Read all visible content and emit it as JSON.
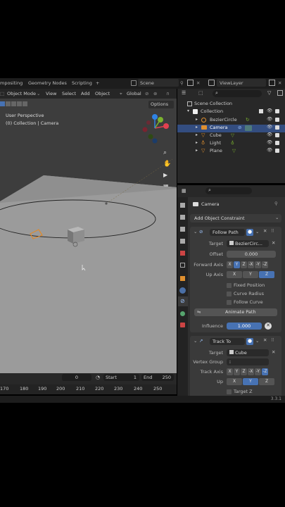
{
  "workspace_tabs": [
    "mpositing",
    "Geometry Nodes",
    "Scripting"
  ],
  "add_tab_label": "+",
  "scene_name": "Scene",
  "view_layer": "ViewLayer",
  "viewport": {
    "mode": "Object Mode",
    "menus": [
      "View",
      "Select",
      "Add",
      "Object"
    ],
    "orientation": "Global",
    "options_label": "Options",
    "perspective_label": "User Perspective",
    "collection_label": "(0) Collection | Camera",
    "gizmo_axes": [
      "X",
      "Y",
      "Z"
    ]
  },
  "timeline": {
    "current_frame": "0",
    "start_label": "Start",
    "start_value": "1",
    "end_label": "End",
    "end_value": "250",
    "ruler": [
      "170",
      "180",
      "190",
      "200",
      "210",
      "220",
      "230",
      "240",
      "250"
    ]
  },
  "outliner": {
    "root": "Scene Collection",
    "collection": "Collection",
    "items": [
      "BezierCircle",
      "Camera",
      "Cube",
      "Light",
      "Plane"
    ],
    "selected": "Camera"
  },
  "properties": {
    "object_name": "Camera",
    "add_constraint": "Add Object Constraint",
    "follow_path": {
      "name": "Follow Path",
      "target_label": "Target",
      "target_value": "BezierCirc...",
      "offset_label": "Offset",
      "offset_value": "0.000",
      "forward_axis_label": "Forward Axis",
      "forward_axis_options": [
        "X",
        "Y",
        "Z",
        "-X",
        "-Y",
        "-Z"
      ],
      "forward_axis_selected": "Y",
      "up_axis_label": "Up Axis",
      "up_axis_options": [
        "X",
        "Y",
        "Z"
      ],
      "up_axis_selected": "Z",
      "fixed_position": "Fixed Position",
      "curve_radius": "Curve Radius",
      "follow_curve": "Follow Curve",
      "animate_path": "Animate Path",
      "influence_label": "Influence",
      "influence_value": "1.000"
    },
    "track_to": {
      "name": "Track To",
      "target_label": "Target",
      "target_value": "Cube",
      "vertex_group_label": "Vertex Group",
      "track_axis_label": "Track Axis",
      "track_axis_options": [
        "X",
        "Y",
        "Z",
        "-X",
        "-Y",
        "-Z"
      ],
      "track_axis_selected": "-Z",
      "up_label": "Up",
      "up_options": [
        "X",
        "Y",
        "Z"
      ],
      "up_selected": "Y",
      "target_z": "Target Z"
    }
  },
  "version": "3.3.1"
}
